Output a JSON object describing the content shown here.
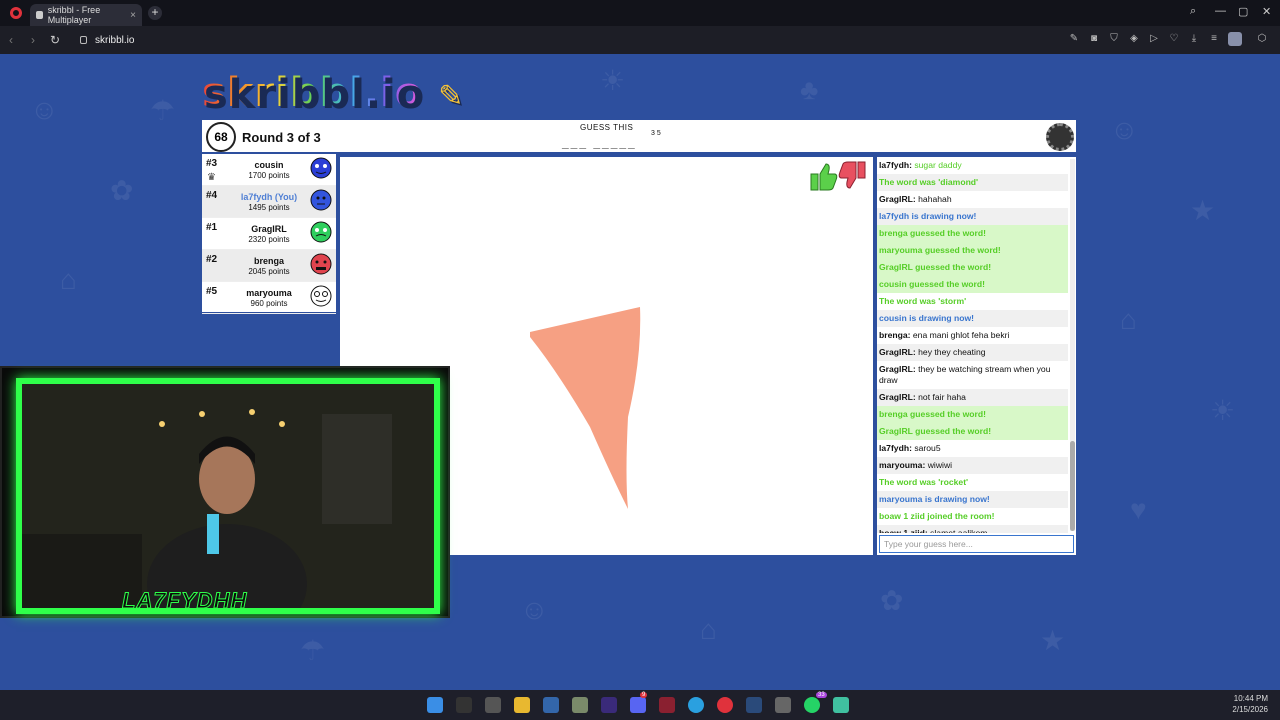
{
  "browser": {
    "tab_title": "skribbl - Free Multiplayer",
    "tab_close": "×",
    "new_tab": "+",
    "url": "skribbl.io",
    "controls": {
      "min": "—",
      "max": "▢",
      "close": "✕"
    }
  },
  "game": {
    "logo": "skribbl.io",
    "timer": "68",
    "round_text": "Round 3 of 3",
    "guess_label": "GUESS THIS",
    "hint": "___ _____",
    "hint_lengths": "3 5",
    "players": [
      {
        "rank": "#3",
        "name": "cousin",
        "points": "1700 points",
        "you": false,
        "color": "#2b3fd6"
      },
      {
        "rank": "#4",
        "name": "la7fydh (You)",
        "points": "1495 points",
        "you": true,
        "color": "#3355dd"
      },
      {
        "rank": "#1",
        "name": "GragIRL",
        "points": "2320 points",
        "you": false,
        "color": "#2fcf5e"
      },
      {
        "rank": "#2",
        "name": "brenga",
        "points": "2045 points",
        "you": false,
        "color": "#e0444e"
      },
      {
        "rank": "#5",
        "name": "maryouma",
        "points": "960 points",
        "you": false,
        "color": "#ffffff"
      }
    ],
    "drawing_color": "#f6a083"
  },
  "chat": {
    "messages": [
      {
        "user": "la7fydh:",
        "text": " sugar daddy",
        "style": "user-green"
      },
      {
        "user": "",
        "text": "The word was 'diamond'",
        "style": "green"
      },
      {
        "user": "GragIRL:",
        "text": " hahahah",
        "style": "normal"
      },
      {
        "user": "",
        "text": "la7fydh is drawing now!",
        "style": "blue"
      },
      {
        "user": "",
        "text": "brenga guessed the word!",
        "style": "greenbg"
      },
      {
        "user": "",
        "text": "maryouma guessed the word!",
        "style": "greenbg"
      },
      {
        "user": "",
        "text": "GragIRL guessed the word!",
        "style": "greenbg"
      },
      {
        "user": "",
        "text": "cousin guessed the word!",
        "style": "greenbg"
      },
      {
        "user": "",
        "text": "The word was 'storm'",
        "style": "green"
      },
      {
        "user": "",
        "text": "cousin is drawing now!",
        "style": "blue"
      },
      {
        "user": "brenga:",
        "text": " ena mani ghlot feha bekri",
        "style": "normal"
      },
      {
        "user": "GragIRL:",
        "text": " hey they cheating",
        "style": "normal"
      },
      {
        "user": "GragIRL:",
        "text": " they be watching stream when you draw",
        "style": "normal"
      },
      {
        "user": "GragIRL:",
        "text": " not fair haha",
        "style": "normal"
      },
      {
        "user": "",
        "text": "brenga guessed the word!",
        "style": "greenbg"
      },
      {
        "user": "",
        "text": "GragIRL guessed the word!",
        "style": "greenbg"
      },
      {
        "user": "la7fydh:",
        "text": " sarou5",
        "style": "normal"
      },
      {
        "user": "maryouma:",
        "text": " wiwiwi",
        "style": "normal"
      },
      {
        "user": "",
        "text": "The word was 'rocket'",
        "style": "green"
      },
      {
        "user": "",
        "text": "maryouma is drawing now!",
        "style": "blue"
      },
      {
        "user": "",
        "text": "boaw 1 ziid joined the room!",
        "style": "green"
      },
      {
        "user": "boaw 1 ziid:",
        "text": " slamet aalikom",
        "style": "normal"
      }
    ],
    "input_placeholder": "Type your guess here..."
  },
  "webcam": {
    "name": "LA7FYDHH"
  },
  "taskbar": {
    "time": "10:44 PM",
    "date": "2/15/2026",
    "notifications": {
      "discord": "9",
      "whatsapp": "33"
    }
  }
}
